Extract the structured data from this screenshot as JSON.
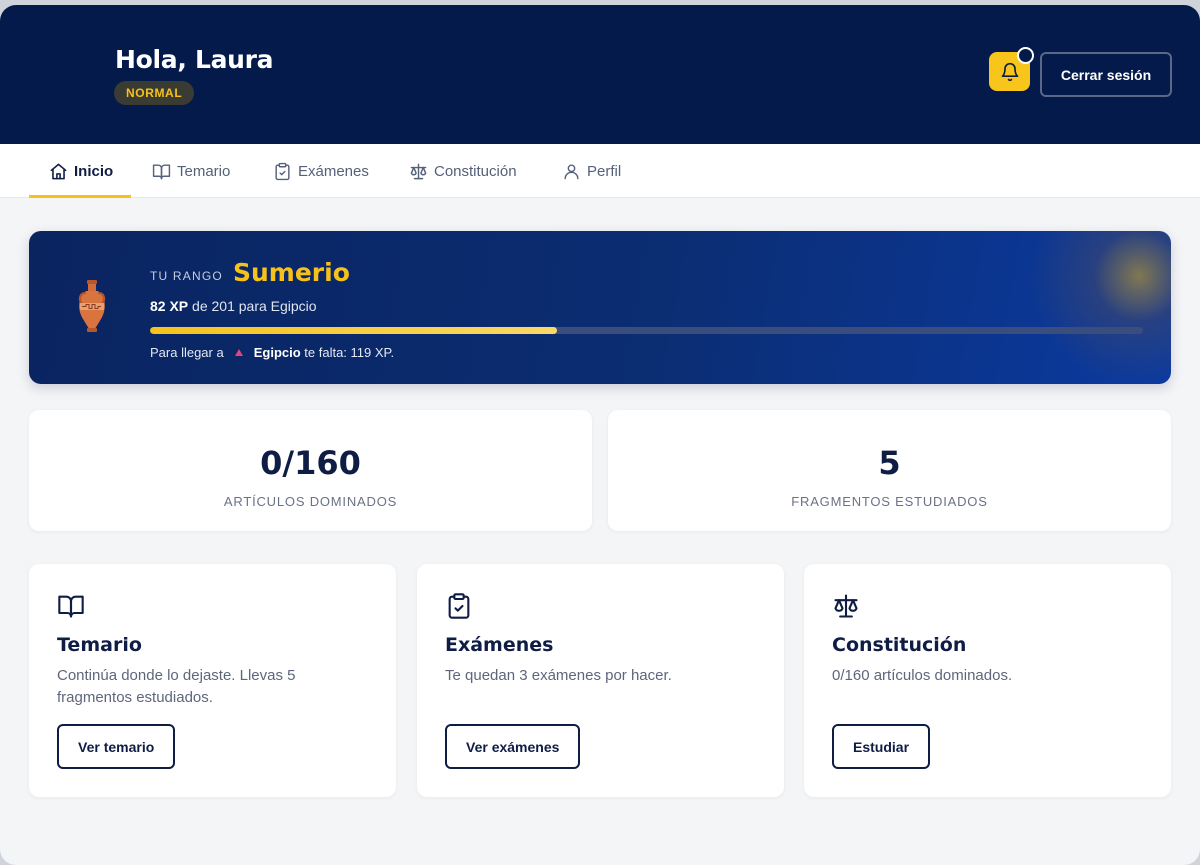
{
  "header": {
    "greeting": "Hola, Laura",
    "level_badge": "NORMAL",
    "logout_label": "Cerrar sesión"
  },
  "tabs": [
    {
      "label": "Inicio",
      "icon": "home-icon",
      "active": true
    },
    {
      "label": "Temario",
      "icon": "book-icon",
      "active": false
    },
    {
      "label": "Exámenes",
      "icon": "clipboard-check-icon",
      "active": false
    },
    {
      "label": "Constitución",
      "icon": "scales-icon",
      "active": false
    },
    {
      "label": "Perfil",
      "icon": "user-icon",
      "active": false
    }
  ],
  "rank": {
    "label": "TU RANGO",
    "name": "Sumerio",
    "xp_current": "82 XP",
    "xp_rest": " de 201 para Egipcio",
    "progress": 0.41,
    "next_prefix": "Para llegar a",
    "next_rank": "Egipcio",
    "next_suffix": " te falta: 119 XP.",
    "icon": "amphora-icon"
  },
  "stats": [
    {
      "value": "0/160",
      "label": "ARTÍCULOS DOMINADOS"
    },
    {
      "value": "5",
      "label": "FRAGMENTOS ESTUDIADOS"
    }
  ],
  "features": [
    {
      "icon": "book-icon",
      "title": "Temario",
      "description": "Continúa donde lo dejaste. Llevas 5 fragmentos estudiados.",
      "button": "Ver temario"
    },
    {
      "icon": "clipboard-check-icon",
      "title": "Exámenes",
      "description": "Te quedan 3 exámenes por hacer.",
      "button": "Ver exámenes"
    },
    {
      "icon": "scales-icon",
      "title": "Constitución",
      "description": "0/160 artículos dominados.",
      "button": "Estudiar"
    }
  ],
  "colors": {
    "navy": "#041a4b",
    "accent_yellow": "#f6c21a",
    "background": "#f4f5f7"
  }
}
